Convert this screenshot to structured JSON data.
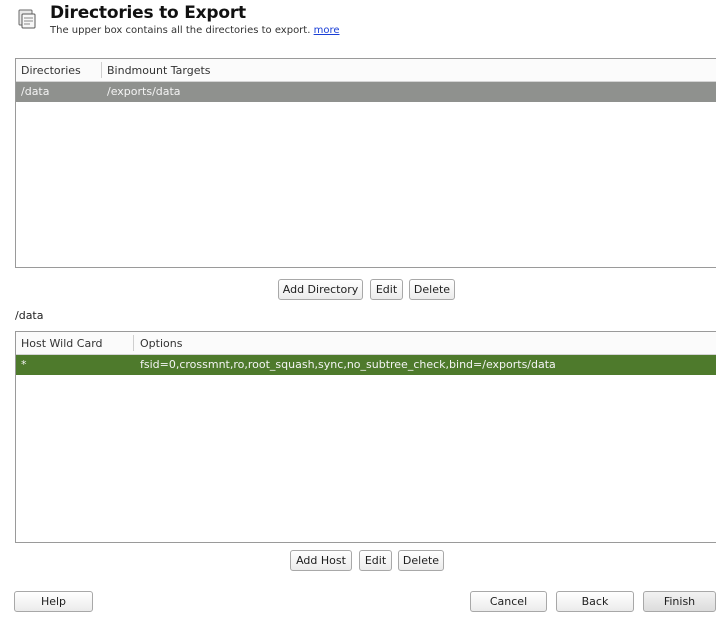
{
  "header": {
    "title": "Directories to Export",
    "subtitle": "The upper box contains all the directories to export.",
    "more_link": "more"
  },
  "directories_table": {
    "columns": [
      "Directories",
      "Bindmount Targets"
    ],
    "rows": [
      {
        "directory": "/data",
        "bindmount": "/exports/data"
      }
    ]
  },
  "directory_buttons": {
    "add": "Add Directory",
    "edit": "Edit",
    "delete": "Delete"
  },
  "selected_path": "/data",
  "hosts_table": {
    "columns": [
      "Host Wild Card",
      "Options"
    ],
    "rows": [
      {
        "host": "*",
        "options": "fsid=0,crossmnt,ro,root_squash,sync,no_subtree_check,bind=/exports/data"
      }
    ]
  },
  "host_buttons": {
    "add": "Add Host",
    "edit": "Edit",
    "delete": "Delete"
  },
  "footer": {
    "help": "Help",
    "cancel": "Cancel",
    "back": "Back",
    "finish": "Finish"
  },
  "colors": {
    "directory_row_selected": "#8f918e",
    "host_row_selected": "#4e7a2c",
    "link": "#1a3fd6"
  },
  "icons": {
    "header": "folder-export-icon"
  }
}
